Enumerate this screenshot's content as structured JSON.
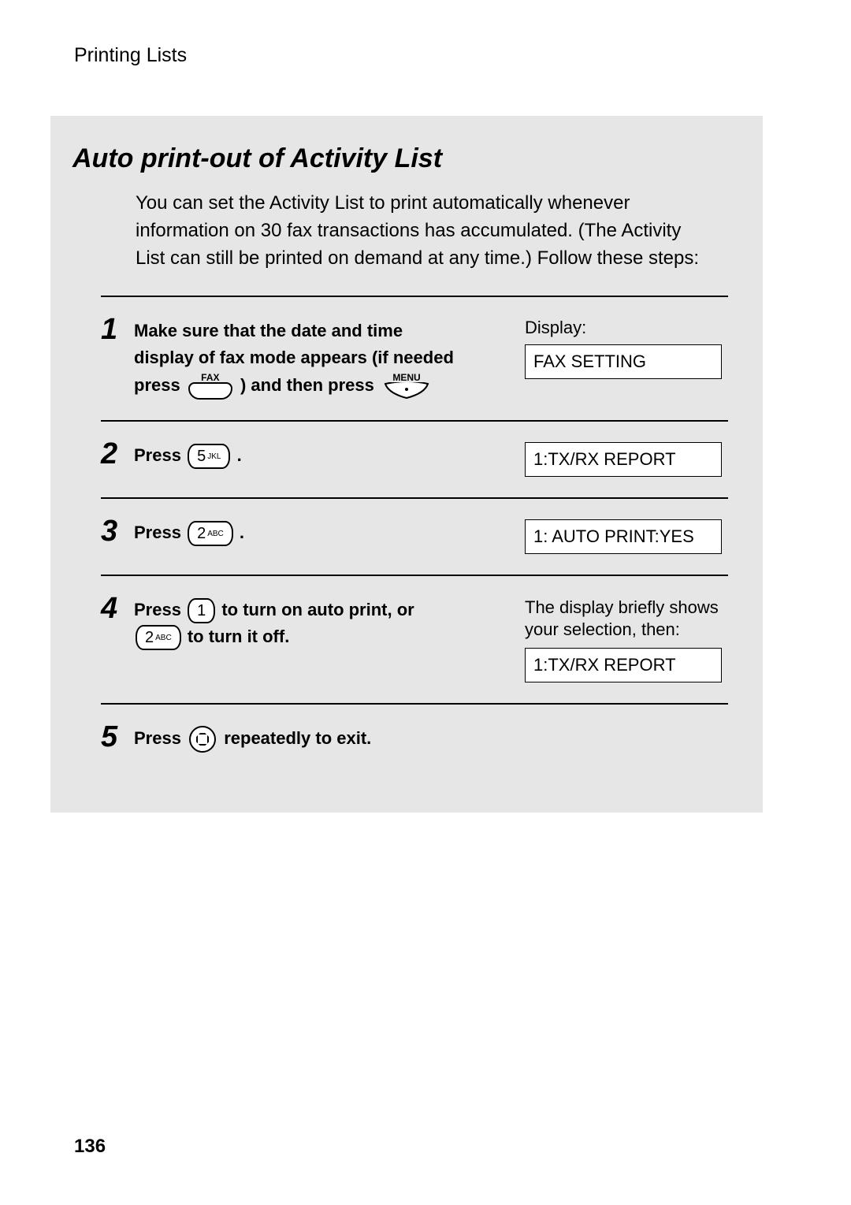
{
  "header": "Printing Lists",
  "section_title": "Auto print-out of Activity List",
  "intro": "You can set the Activity List to print automatically whenever information on 30 fax transactions has accumulated. (The Activity List can still be printed on demand at any time.) Follow these steps:",
  "keys": {
    "fax_label": "FAX",
    "menu_label": "MENU",
    "key5": {
      "num": "5",
      "sub": "JKL"
    },
    "key2": {
      "num": "2",
      "sub": "ABC"
    },
    "key1": {
      "num": "1",
      "sub": ""
    }
  },
  "steps": {
    "s1": {
      "num": "1",
      "line1": "Make sure that the date and time",
      "line2": "display of fax mode appears (if needed",
      "press": "press",
      "and_then_press": ") and then press",
      "display_label": "Display:",
      "display_value": "FAX SETTING"
    },
    "s2": {
      "num": "2",
      "press": "Press",
      "period": ".",
      "display_value": "1:TX/RX REPORT"
    },
    "s3": {
      "num": "3",
      "press": "Press",
      "period": ".",
      "display_value": "1: AUTO PRINT:YES"
    },
    "s4": {
      "num": "4",
      "press": "Press",
      "text_a": "to turn on auto print, or",
      "text_b": "to turn it off.",
      "note": "The display briefly shows your selection, then:",
      "display_value": "1:TX/RX REPORT"
    },
    "s5": {
      "num": "5",
      "press": "Press",
      "text": "repeatedly to exit."
    }
  },
  "page_number": "136"
}
